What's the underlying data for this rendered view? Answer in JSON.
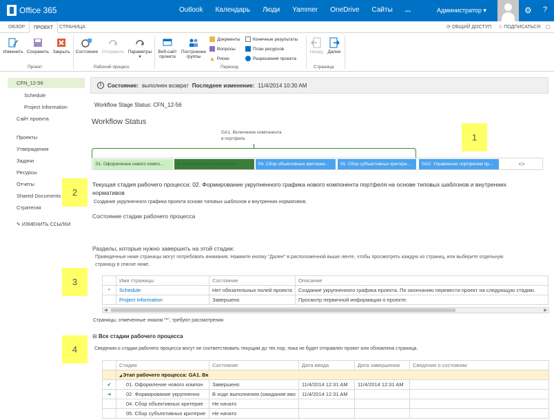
{
  "suite": {
    "name": "Office 365",
    "nav": [
      "Outlook",
      "Календарь",
      "Люди",
      "Yammer",
      "OneDrive",
      "Сайты",
      "..."
    ],
    "user": "Администратор ▾",
    "gear": "⚙",
    "help": "?"
  },
  "ribbon_tabs": {
    "tabs": [
      "ОБЗОР",
      "ПРОЕКТ",
      "СТРАНИЦА"
    ],
    "active": "ПРОЕКТ",
    "share": "ОБЩИЙ ДОСТУП",
    "follow": "ПОДПИСАТЬСЯ"
  },
  "ribbon": {
    "project_group": {
      "label": "Проект",
      "edit": "Изменить",
      "save": "Сохранить",
      "close": "Закрыть"
    },
    "workflow_group": {
      "label": "Рабочий процесс",
      "status": "Состояние",
      "submit": "Отправить",
      "params": "Параметры"
    },
    "navigate_group": {
      "label": "Переход",
      "website_l1": "Веб-сайт",
      "website_l2": "проекта",
      "build_l1": "Построение",
      "build_l2": "группы",
      "documents": "Документы",
      "issues": "Вопросы",
      "risks": "Риски",
      "deliverables": "Конечные результаты",
      "resource_plan": "План ресурсов",
      "permissions": "Разрешения проекта"
    },
    "page_group": {
      "label": "Страница",
      "back": "Назад",
      "next": "Далее"
    }
  },
  "leftnav": {
    "items": [
      "CFN_12-56",
      "Schedule",
      "Project Information",
      "Сайт проекта",
      "Проекты",
      "Утверждения",
      "Задачи",
      "Ресурсы",
      "Отчеты",
      "Shared Documents",
      "Стратегия",
      "ИЗМЕНИТЬ ССЫЛКИ"
    ]
  },
  "status": {
    "label": "Состояние:",
    "value": "выполнен возврат",
    "changed_label": "Последнее изменение:",
    "changed_value": "11/4/2014 10:30 AM"
  },
  "workflow": {
    "stage_status": "Workflow Stage Status: CFN_12-56",
    "title": "Workflow Status",
    "phase_label_l1": "GA1. Включение компонента",
    "phase_label_l2": "в портфель",
    "stages": [
      "01. Оформление нового компо...",
      "Формирование укрупненного...",
      "04. Сбор объективных критерие...",
      "05. Сбор субъективных критери...",
      "GA2. Управление портфелем пр...",
      "<>"
    ],
    "current_prefix": "Текущая стадия рабочего процесса:",
    "current_l1": "02. Формирование укрупненного графика нового компонента портфеля на основе типовых шаблонов и внутренних",
    "current_l2": "нормативов",
    "current_desc": "Создание укрупненного графика проекта основе типовых шаблонов и внутренних нормативов.",
    "stage_state_title": "Состояние стадии рабочего процесса"
  },
  "sections": {
    "title": "Разделы, которые нужно завершить на этой стадии:",
    "desc_l1": "Приведенные ниже страницы могут потребовать внимания. Нажмите кнопку \"Далее\" в расположенной выше ленте, чтобы просмотреть каждую из страниц, или выберите отдельную",
    "desc_l2": "страницу в списке ниже.",
    "headers": [
      "Имя страницы",
      "Состояние",
      "Описание"
    ],
    "rows": [
      {
        "mark": "*",
        "name": "Schedule",
        "state": "Нет обязательных полей проекта",
        "desc": "Создание укрупненного графика проекта. По окончанию перевести проект на следующую стадию."
      },
      {
        "mark": "",
        "name": "Project Information",
        "state": "Завершено",
        "desc": "Просмотр первичной информации о проекте."
      }
    ],
    "note": "Страницы, отмеченные знаком \"*\", требуют рассмотрения"
  },
  "all_stages": {
    "title": "Все стадии рабочего процесса",
    "desc": "Сведения о стадии рабочего процесса могут не соответствовать текущим до тех пор, пока не будет отправлен проект или обновлена страница.",
    "headers": [
      "Стадия",
      "Состояние",
      "Дата ввода",
      "Дата завершения",
      "Сведения о состоянии"
    ],
    "phase": "Этап рабочего процесса: GA1. Вк",
    "rows": [
      {
        "icon": "✔",
        "stage": "01. Оформление нового компон",
        "state": "Завершено",
        "entered": "11/4/2014 12:31 AM",
        "completed": "11/4/2014 12:31 AM",
        "info": ""
      },
      {
        "icon": "➜",
        "stage": "02. Формирование укрупненно",
        "state": "В ходе выполнения (ожидание вво",
        "entered": "11/4/2014 12:31 AM",
        "completed": "",
        "info": ""
      },
      {
        "icon": "",
        "stage": "04. Сбор объективных критерие",
        "state": "Не начато",
        "entered": "",
        "completed": "",
        "info": ""
      },
      {
        "icon": "",
        "stage": "05. Сбор субъективных критерие",
        "state": "Не начато",
        "entered": "",
        "completed": "",
        "info": ""
      }
    ]
  },
  "callouts": [
    "1",
    "2",
    "3",
    "4"
  ],
  "colors": {
    "suite_blue": "#0072c6",
    "stage_done": "#ccefc2",
    "stage_current": "#3b7d3b",
    "stage_future": "#4aa3ef",
    "callout": "#ffff66",
    "phase_row": "#fff2cc"
  }
}
